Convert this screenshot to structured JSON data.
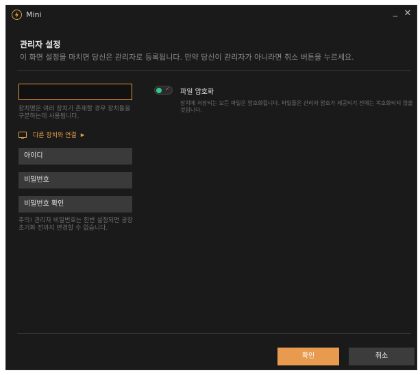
{
  "window": {
    "title": "Mini",
    "minimize_glyph": "_",
    "close_glyph": "✕"
  },
  "header": {
    "title": "관리자 설정",
    "subtitle": "이 화면 설정을 마치면 당신은 관리자로 등록됩니다. 만약 당신이 관리자가 아니라면 취소 버튼을 누르세요."
  },
  "device": {
    "input_value": "",
    "hint": "장치명은 여러 장치가 존재할 경우 장치들을 구분하는데 사용됩니다.",
    "connect_label": "다른 장치와 연결"
  },
  "fields": {
    "id_label": "아이디",
    "password_label": "비밀번호",
    "password_confirm_label": "비밀번호 확인"
  },
  "password_hint": "주의! 관리자 비밀번호는 한번 설정되면 공장 초기화 전까지 변경할 수 없습니다.",
  "encryption": {
    "label": "파일 암호화",
    "enabled": true,
    "description": "장치에 저장되는 모든 파일은 암호화됩니다. 파일들은 관리자 암호가 제공되기 전에는 복호화되지 않을 것입니다."
  },
  "actions": {
    "confirm_label": "확인",
    "cancel_label": "취소"
  },
  "colors": {
    "accent": "#e89a4e",
    "toggle_on": "#2ecc8a",
    "background": "#1a1a1a"
  }
}
